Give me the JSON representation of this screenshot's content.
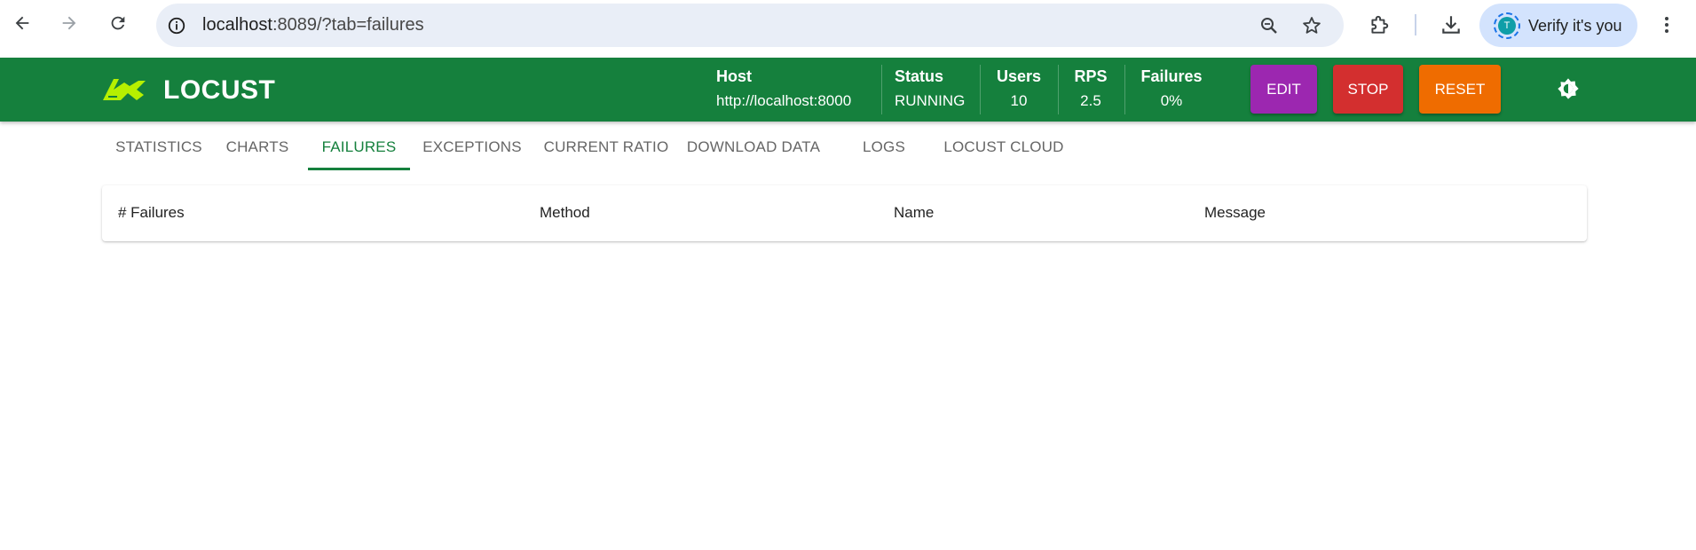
{
  "browser": {
    "url_host": "localhost",
    "url_path": ":8089/?tab=failures",
    "profile_initial": "T",
    "profile_label": "Verify it's you"
  },
  "header": {
    "logo_text": "LOCUST",
    "stats": [
      {
        "label": "Host",
        "value": "http://localhost:8000"
      },
      {
        "label": "Status",
        "value": "RUNNING"
      },
      {
        "label": "Users",
        "value": "10"
      },
      {
        "label": "RPS",
        "value": "2.5"
      },
      {
        "label": "Failures",
        "value": "0%"
      }
    ],
    "buttons": {
      "edit": "EDIT",
      "stop": "STOP",
      "reset": "RESET"
    },
    "colors": {
      "header_bg": "#15803d",
      "edit": "#9c27b0",
      "stop": "#d32f2f",
      "reset": "#ef6c00",
      "logo_accent": "#b6f000"
    }
  },
  "tabs": [
    {
      "label": "STATISTICS",
      "active": false
    },
    {
      "label": "CHARTS",
      "active": false
    },
    {
      "label": "FAILURES",
      "active": true
    },
    {
      "label": "EXCEPTIONS",
      "active": false
    },
    {
      "label": "CURRENT RATIO",
      "active": false
    },
    {
      "label": "DOWNLOAD DATA",
      "active": false
    },
    {
      "label": "LOGS",
      "active": false
    },
    {
      "label": "LOCUST CLOUD",
      "active": false
    }
  ],
  "failures_table": {
    "columns": [
      "# Failures",
      "Method",
      "Name",
      "Message"
    ],
    "rows": []
  },
  "icons": {
    "back": "arrow-back-icon",
    "forward": "arrow-forward-icon",
    "reload": "reload-icon",
    "site_info": "info-icon",
    "zoom": "zoom-icon",
    "bookmark": "star-icon",
    "extensions": "puzzle-icon",
    "downloads": "download-icon",
    "menu": "kebab-menu-icon",
    "theme": "brightness-icon"
  }
}
